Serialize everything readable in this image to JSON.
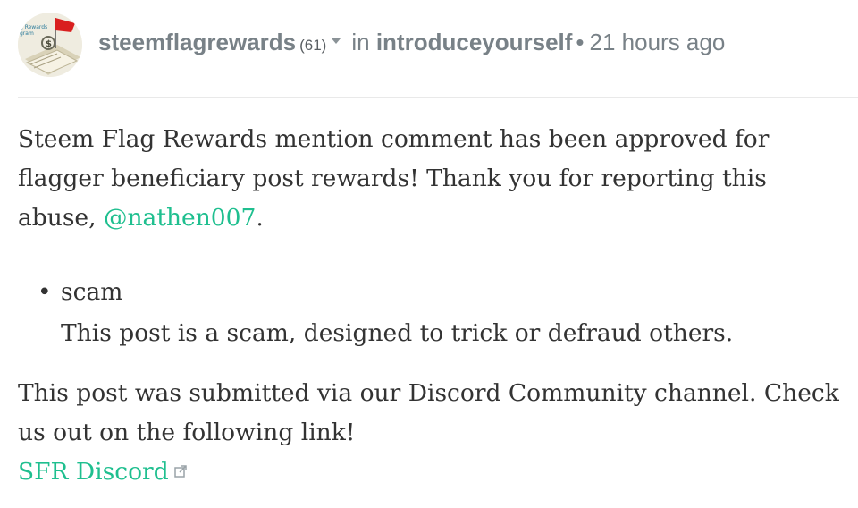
{
  "header": {
    "author": "steemflagrewards",
    "reputation": "(61)",
    "in_label": "in",
    "category": "introduceyourself",
    "separator": "•",
    "timestamp": "21 hours ago",
    "avatar_text": [
      "g Rewards",
      "gram"
    ]
  },
  "comment": {
    "paragraph1_text": "Steem Flag Rewards mention comment has been approved for flagger beneficiary post rewards! Thank you for reporting this abuse, ",
    "mention": "@nathen007",
    "paragraph1_end": ".",
    "list_items": [
      {
        "bullet": "•",
        "title": "scam",
        "description": "This post is a scam, designed to trick or defraud others."
      }
    ],
    "paragraph2_text": "This post was submitted via our Discord Community channel. Check us out on the following link!",
    "discord_link": "SFR Discord"
  },
  "colors": {
    "link": "#1fbf8f",
    "meta": "#788187",
    "text": "#333333"
  }
}
